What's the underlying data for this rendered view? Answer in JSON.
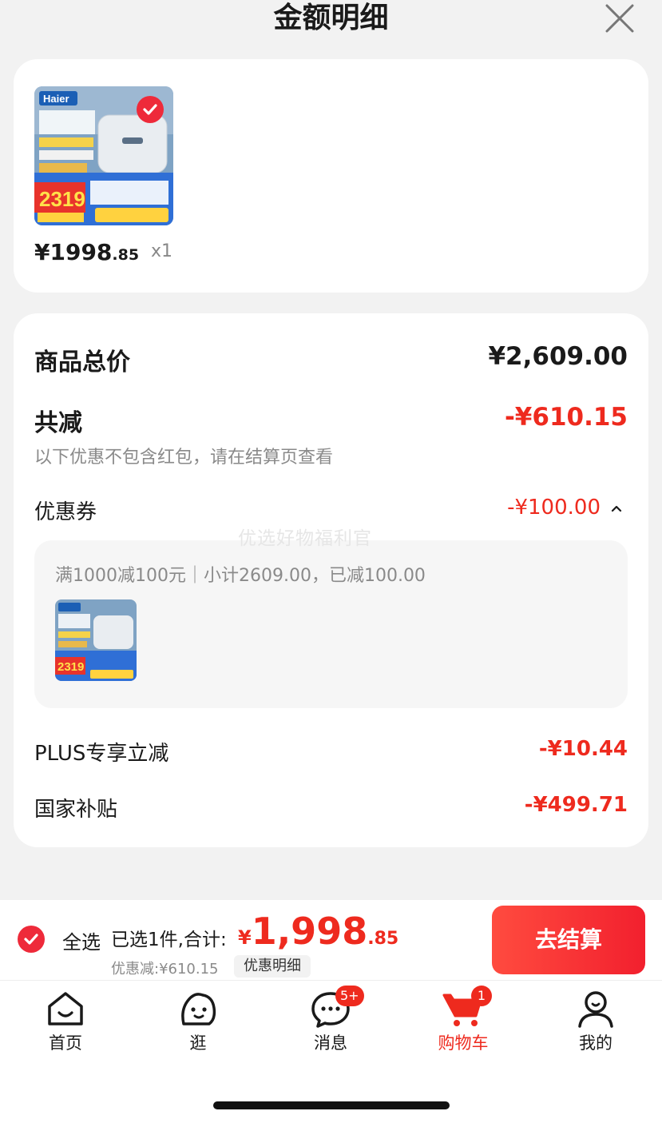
{
  "header": {
    "title": "金额明细"
  },
  "product": {
    "price_currency": "¥",
    "price_int": "1998",
    "price_dec": ".85",
    "quantity": "x1",
    "thumb_brand": "Haier",
    "thumb_price": "2319"
  },
  "summary": {
    "total_label": "商品总价",
    "total_value": "¥2,609.00",
    "reduce_label": "共减",
    "reduce_value": "-¥610.15",
    "reduce_note": "以下优惠不包含红包，请在结算页查看",
    "coupon_label": "优惠券",
    "coupon_value": "-¥100.00",
    "coupon_detail": "满1000减100元｜小计2609.00，已减100.00",
    "plus_label": "PLUS专享立减",
    "plus_value": "-¥10.44",
    "subsidy_label": "国家补贴",
    "subsidy_value": "-¥499.71",
    "watermark": "优选好物福利官"
  },
  "checkout": {
    "select_all_label": "全选",
    "selected_text": "已选1件,合计:",
    "total_currency": "¥",
    "total_int": "1,998",
    "total_dec": ".85",
    "discount_text": "优惠减:¥610.15",
    "discount_detail_label": "优惠明细",
    "checkout_label": "去结算"
  },
  "tabbar": {
    "items": [
      {
        "label": "首页",
        "icon": "home-icon"
      },
      {
        "label": "逛",
        "icon": "browse-icon"
      },
      {
        "label": "消息",
        "icon": "message-icon",
        "badge": "5+"
      },
      {
        "label": "购物车",
        "icon": "cart-icon",
        "badge": "1",
        "active": true
      },
      {
        "label": "我的",
        "icon": "profile-icon"
      }
    ]
  },
  "colors": {
    "accent": "#ee2a1e",
    "background": "#f2f2f2"
  }
}
